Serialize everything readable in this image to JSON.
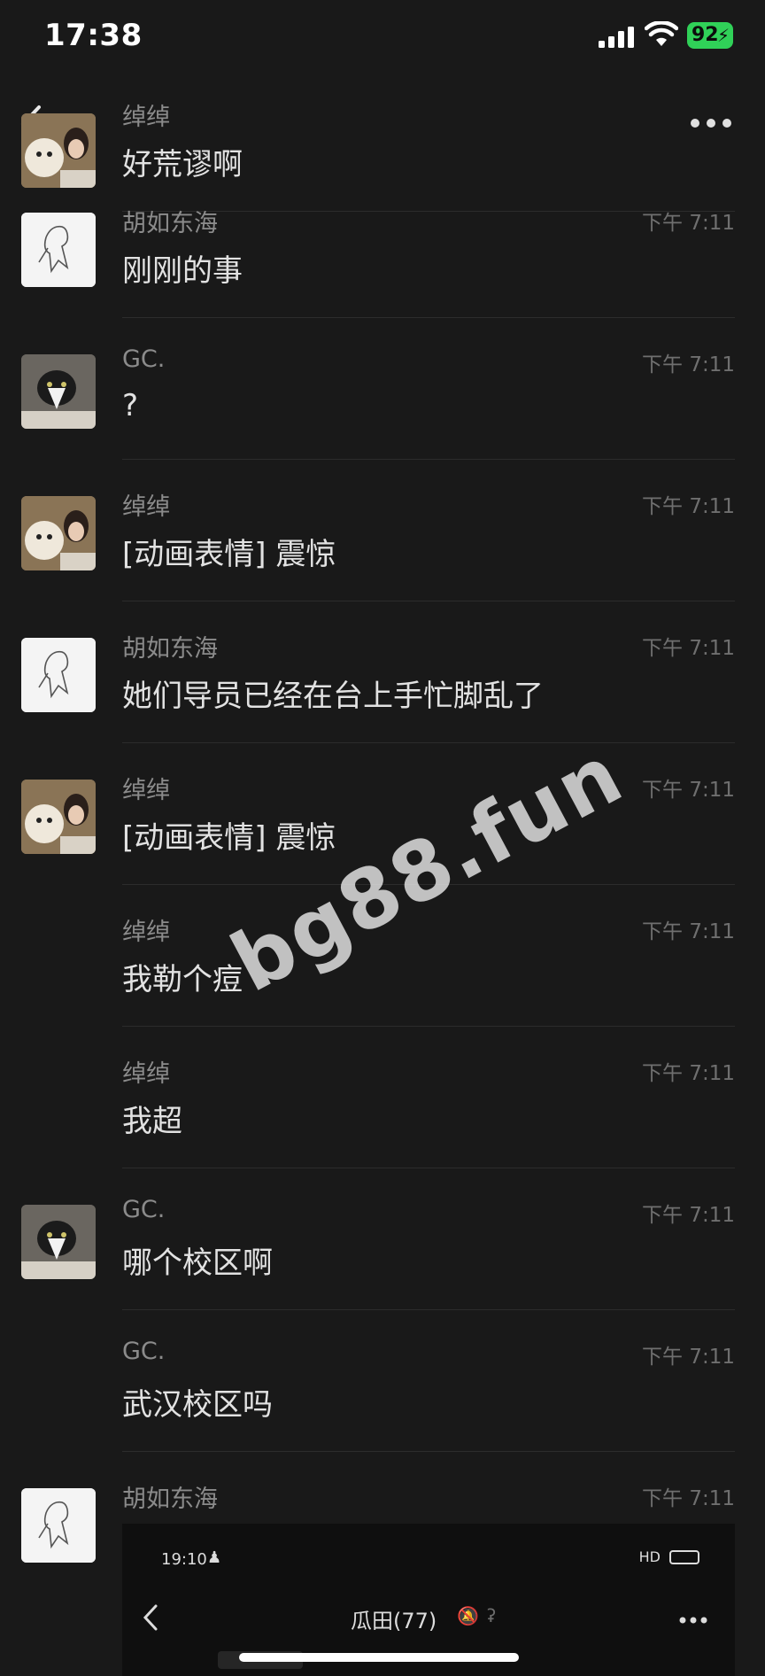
{
  "status_bar": {
    "time": "17:38",
    "battery": "92"
  },
  "messages": [
    {
      "sender": "绰绰",
      "time": "",
      "text": "好荒谬啊",
      "avatar": "dog-girl"
    },
    {
      "sender": "胡如东海",
      "time": "下午 7:11",
      "text": "刚刚的事",
      "avatar": "sketch"
    },
    {
      "sender": "GC.",
      "time": "下午 7:11",
      "text": "?",
      "avatar": "cat"
    },
    {
      "sender": "绰绰",
      "time": "下午 7:11",
      "text": "[动画表情] 震惊",
      "avatar": "dog-girl"
    },
    {
      "sender": "胡如东海",
      "time": "下午 7:11",
      "text": "她们导员已经在台上手忙脚乱了",
      "avatar": "sketch"
    },
    {
      "sender": "绰绰",
      "time": "下午 7:11",
      "text": "[动画表情] 震惊",
      "avatar": "dog-girl"
    },
    {
      "sender": "绰绰",
      "time": "下午 7:11",
      "text": "我勒个痘",
      "avatar": ""
    },
    {
      "sender": "绰绰",
      "time": "下午 7:11",
      "text": "我超",
      "avatar": ""
    },
    {
      "sender": "GC.",
      "time": "下午 7:11",
      "text": "哪个校区啊",
      "avatar": "cat"
    },
    {
      "sender": "GC.",
      "time": "下午 7:11",
      "text": "武汉校区吗",
      "avatar": ""
    },
    {
      "sender": "胡如东海",
      "time": "下午 7:11",
      "text": "",
      "avatar": "sketch"
    }
  ],
  "watermark": "bg88.fun",
  "embedded": {
    "time": "19:10",
    "title": "瓜田(77)",
    "status_text": "HD"
  },
  "colors": {
    "background": "#191919",
    "battery": "#30d158",
    "divider": "#2c2c2c"
  }
}
